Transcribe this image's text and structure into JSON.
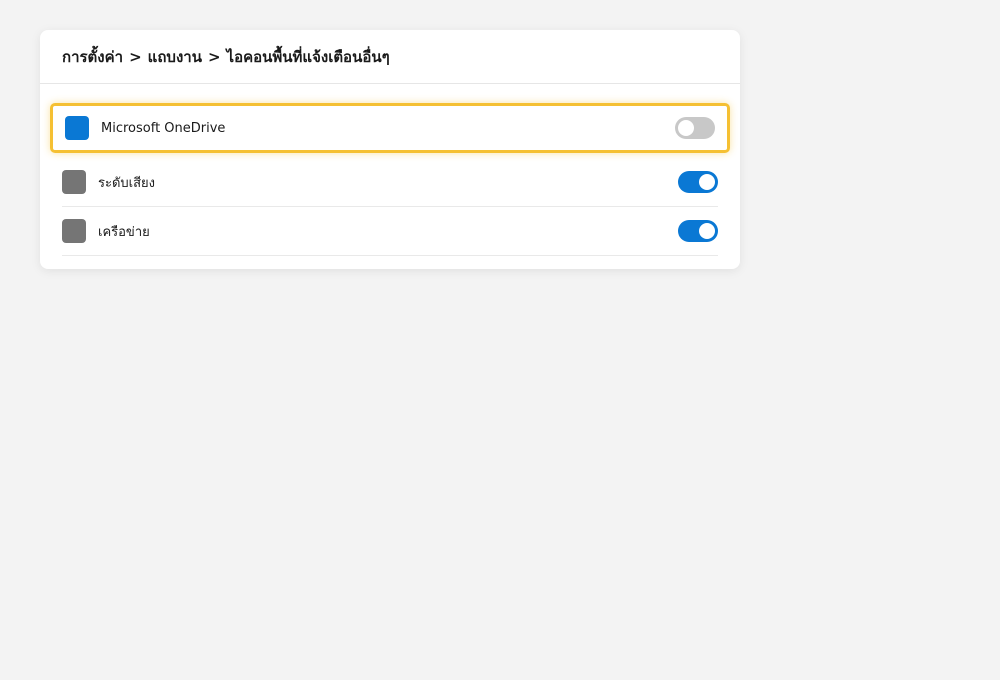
{
  "breadcrumb": {
    "items": [
      "การตั้งค่า",
      "แถบงาน",
      "ไอคอนพื้นที่แจ้งเตือนอื่นๆ"
    ],
    "separator": ">"
  },
  "colors": {
    "accent": "#0a78d4",
    "toggle_off": "#c8c8c8",
    "icon_gray": "#757575",
    "focus_ring": "#f5c033"
  },
  "items": [
    {
      "label": "Microsoft OneDrive",
      "icon": "onedrive-icon",
      "icon_color": "#0a78d4",
      "toggle": "off",
      "focused": true
    },
    {
      "label": "ระดับเสียง",
      "icon": "volume-icon",
      "icon_color": "#757575",
      "toggle": "on",
      "focused": false
    },
    {
      "label": "เครือข่าย",
      "icon": "network-icon",
      "icon_color": "#757575",
      "toggle": "on",
      "focused": false
    }
  ]
}
